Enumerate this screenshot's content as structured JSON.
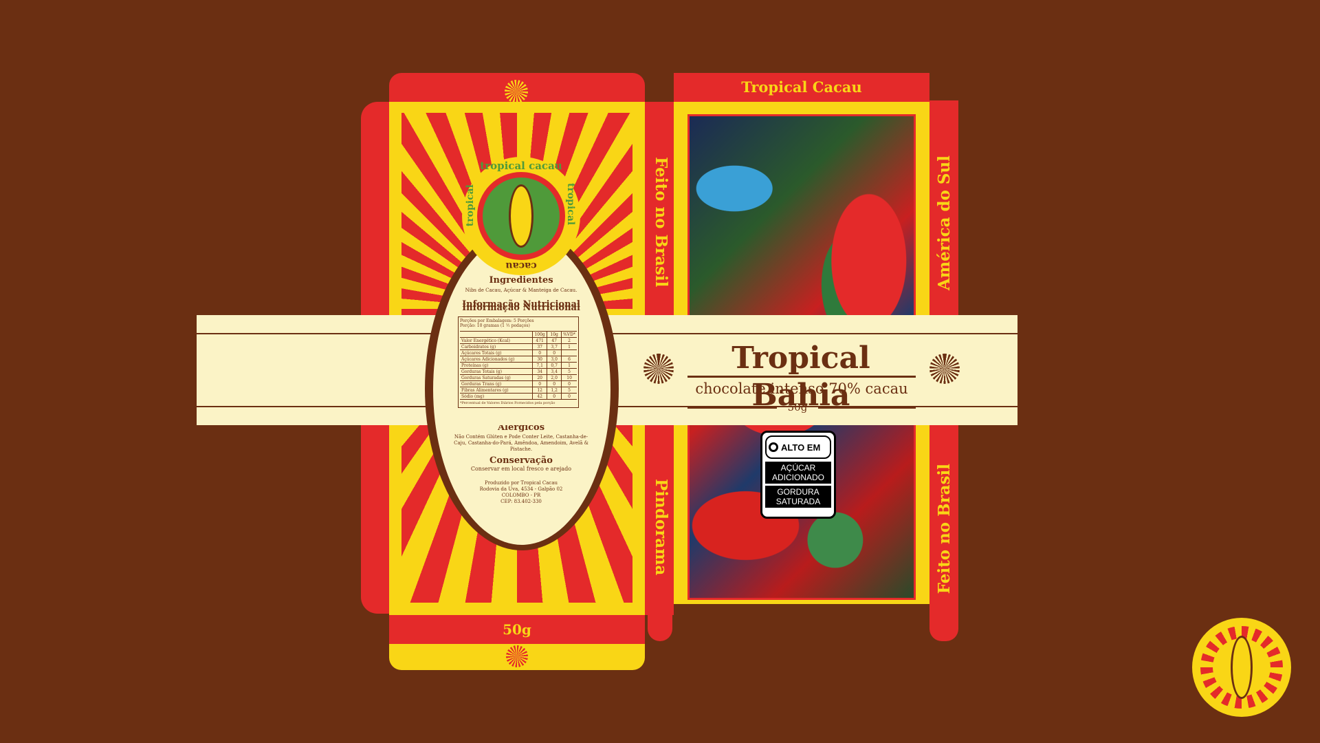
{
  "colors": {
    "background": "#6b2f12",
    "red": "#e42a2a",
    "yellow": "#f9d616",
    "cream": "#fbf3c6",
    "brown": "#6b2f12",
    "green": "#4f9a3a"
  },
  "icons": [
    "sun-icon",
    "cacao-pod-icon",
    "magnifier-icon"
  ],
  "back_panel": {
    "seal_text_top": "tropical cacau",
    "seal_text_right": "tropical",
    "seal_text_bottom": "cacau",
    "seal_text_left": "tropical",
    "seal_text_left2": "cacau",
    "ingredients_title": "Ingredientes",
    "ingredients_text": "Nibs de Cacau, Açúcar & Manteiga de Cacau.",
    "nutrition_title": "Informação Nutricional",
    "portion_line1": "Porções por Embalagem: 5 Porções",
    "portion_line2": "Porção: 10 gramas (1 ½ pedaços)",
    "table_headers": [
      "",
      "100g",
      "10g",
      "%VD*"
    ],
    "table_rows": [
      [
        "Valor Energético (Kcal)",
        "471",
        "47",
        "2"
      ],
      [
        "Carboidratos (g)",
        "37",
        "3,7",
        "1"
      ],
      [
        "Açúcares Totais (g)",
        "0",
        "0",
        ""
      ],
      [
        "Açúcares Adicionados (g)",
        "30",
        "3,0",
        "6"
      ],
      [
        "Proteínas (g)",
        "7,1",
        "0,7",
        "1"
      ],
      [
        "Gorduras Totais (g)",
        "34",
        "3,4",
        "5"
      ],
      [
        "Gorduras Saturadas (g)",
        "20",
        "2,0",
        "10"
      ],
      [
        "Gorduras Trans (g)",
        "0",
        "0",
        "0"
      ],
      [
        "Fibras Alimentares (g)",
        "12",
        "1,2",
        "5"
      ],
      [
        "Sódio (mg)",
        "42",
        "0",
        "0"
      ]
    ],
    "table_footnote": "*Percentual de Valores Diários Fornecidos pela porção",
    "allergens_title": "Alérgicos",
    "allergens_text": "Não Contém Glúten e Pode Conter Leite, Castanha-de-Caju, Castanha-do-Pará, Amêndoa, Amendoim, Avelã & Pistache.",
    "storage_title": "Conservação",
    "storage_text": "Conservar em local fresco e arejado",
    "producer_line1": "Produzido por Tropical Cacau",
    "producer_line2": "Rodovia da Uva, 4534 - Galpão 02",
    "producer_line3": "COLOMBO - PR",
    "producer_line4": "CEP: 83.402-330"
  },
  "side_labels": {
    "feito_no_brasil": "Feito no Brasil",
    "pindorama": "Pindorama",
    "america_do_sul": "América do Sul",
    "feito_no_brasil_2": "Feito no Brasil"
  },
  "bottom_flap": {
    "weight": "50g"
  },
  "front_top_flap": {
    "brand": "Tropical Cacau"
  },
  "band": {
    "product_name": "Tropical Bahia",
    "subtitle": "chocolate intenso 70% cacau",
    "weight": "50g"
  },
  "warning_label": {
    "header": "ALTO EM",
    "line1": "AÇÚCAR",
    "line2": "ADICIONADO",
    "line3": "GORDURA",
    "line4": "SATURADA"
  }
}
